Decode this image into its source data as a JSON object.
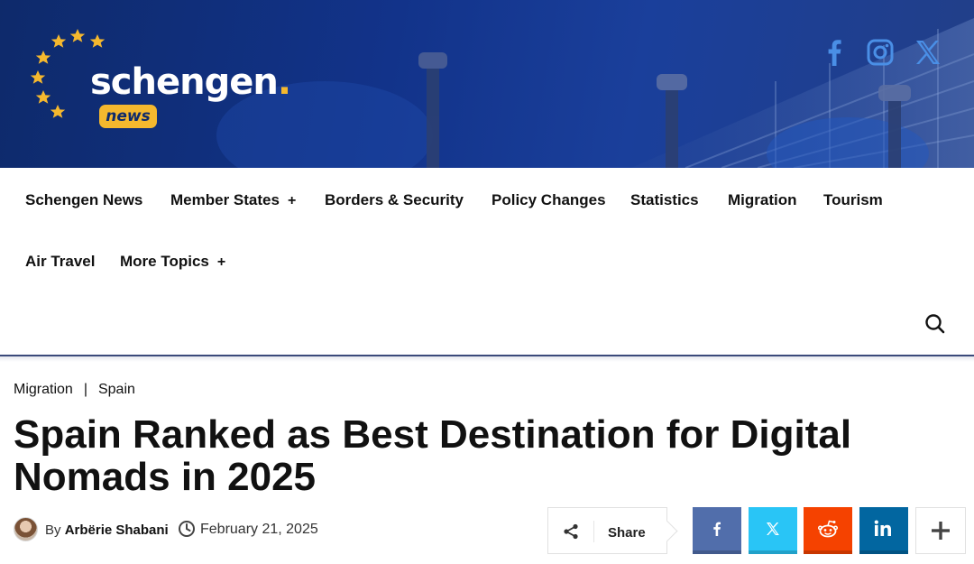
{
  "header": {
    "logo": {
      "word": "schengen",
      "dot": ".",
      "badge": "news"
    },
    "social": [
      {
        "icon": "facebook-icon"
      },
      {
        "icon": "instagram-icon"
      },
      {
        "icon": "x-icon"
      }
    ],
    "colors": {
      "banner": "#12338a",
      "accent": "#f5b82e"
    }
  },
  "nav": {
    "items": [
      {
        "label": "Schengen News"
      },
      {
        "label": "Member States",
        "expand": "+"
      },
      {
        "label": "Borders & Security"
      },
      {
        "label": "Policy Changes"
      },
      {
        "label": "Statistics"
      },
      {
        "label": "Migration"
      },
      {
        "label": "Tourism"
      },
      {
        "label": "Air Travel"
      },
      {
        "label": "More Topics",
        "expand": "+"
      }
    ],
    "search_icon": "search-icon"
  },
  "article": {
    "breadcrumbs": [
      "Migration",
      "Spain"
    ],
    "breadcrumb_sep": "|",
    "title": "Spain Ranked as Best Destination for Digital Nomads in 2025",
    "byline_prefix": "By",
    "author": "Arbërie Shabani",
    "date": "February 21, 2025"
  },
  "share": {
    "label": "Share",
    "buttons": [
      {
        "icon": "facebook-icon",
        "color": "#516eab"
      },
      {
        "icon": "x-icon",
        "color": "#29c5f6"
      },
      {
        "icon": "reddit-icon",
        "color": "#f54200"
      },
      {
        "icon": "linkedin-icon",
        "color": "#0266a0"
      },
      {
        "icon": "plus-icon",
        "color": "#ffffff"
      }
    ]
  }
}
